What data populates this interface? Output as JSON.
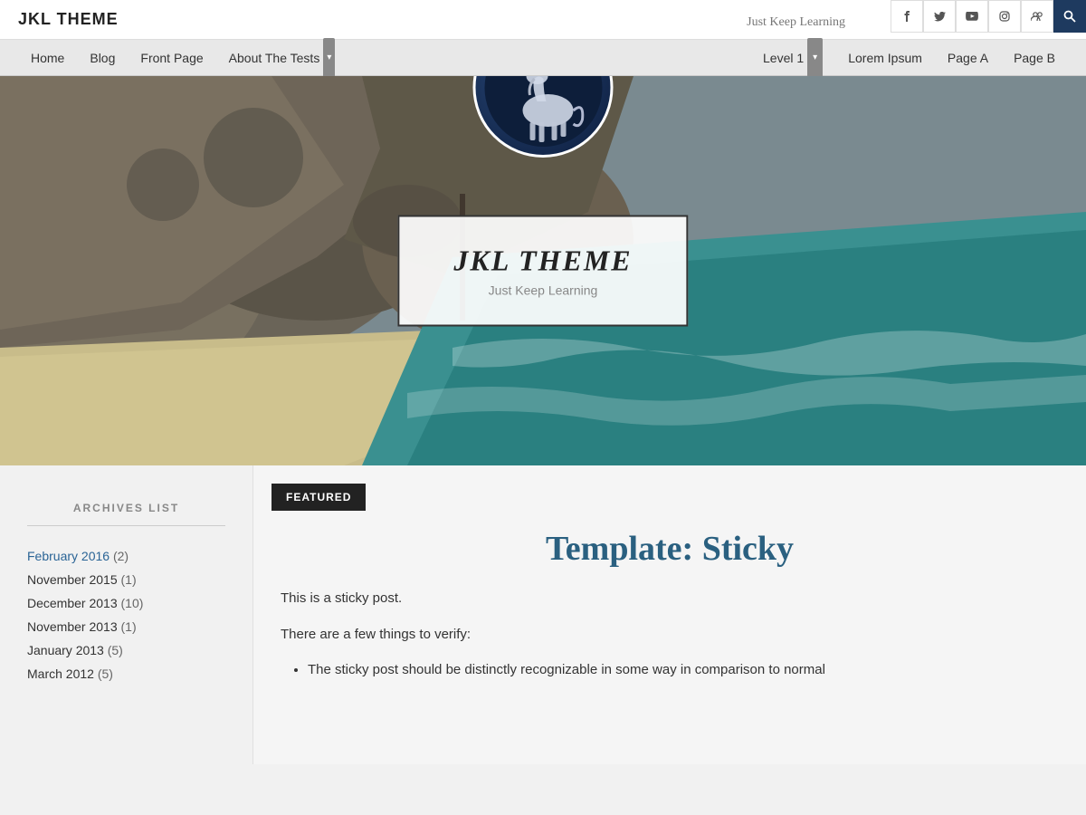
{
  "header": {
    "site_title": "JKL THEME",
    "tagline": "Just Keep Learning",
    "search_icon": "🔍"
  },
  "social": {
    "facebook_icon": "f",
    "twitter_icon": "t",
    "youtube_icon": "▶",
    "instagram_icon": "📷",
    "group_icon": "👥"
  },
  "nav": {
    "items": [
      {
        "label": "Home",
        "has_dropdown": false
      },
      {
        "label": "Blog",
        "has_dropdown": false
      },
      {
        "label": "Front Page",
        "has_dropdown": false
      },
      {
        "label": "About The Tests",
        "has_dropdown": true
      }
    ],
    "right_items": [
      {
        "label": "Level 1",
        "has_dropdown": true
      },
      {
        "label": "Lorem Ipsum",
        "has_dropdown": false
      },
      {
        "label": "Page A",
        "has_dropdown": false
      },
      {
        "label": "Page B",
        "has_dropdown": false
      }
    ]
  },
  "hero": {
    "site_title": "JKL THEME",
    "tagline": "Just Keep Learning",
    "unicorn_emoji": "🦄"
  },
  "sidebar": {
    "archives_title": "ARCHIVES LIST",
    "items": [
      {
        "label": "February 2016",
        "count": "(2)",
        "is_link": true
      },
      {
        "label": "November 2015",
        "count": "(1)",
        "is_link": false
      },
      {
        "label": "December 2013",
        "count": "(10)",
        "is_link": false
      },
      {
        "label": "November 2013",
        "count": "(1)",
        "is_link": false
      },
      {
        "label": "January 2013",
        "count": "(5)",
        "is_link": false
      },
      {
        "label": "March 2012",
        "count": "(5)",
        "is_link": false
      }
    ]
  },
  "featured": {
    "badge": "FEATURED",
    "post_title": "Template: Sticky",
    "intro_line1": "This is a sticky post.",
    "intro_line2": "There are a few things to verify:",
    "bullet1": "The sticky post should be distinctly recognizable in some way in comparison to normal"
  }
}
